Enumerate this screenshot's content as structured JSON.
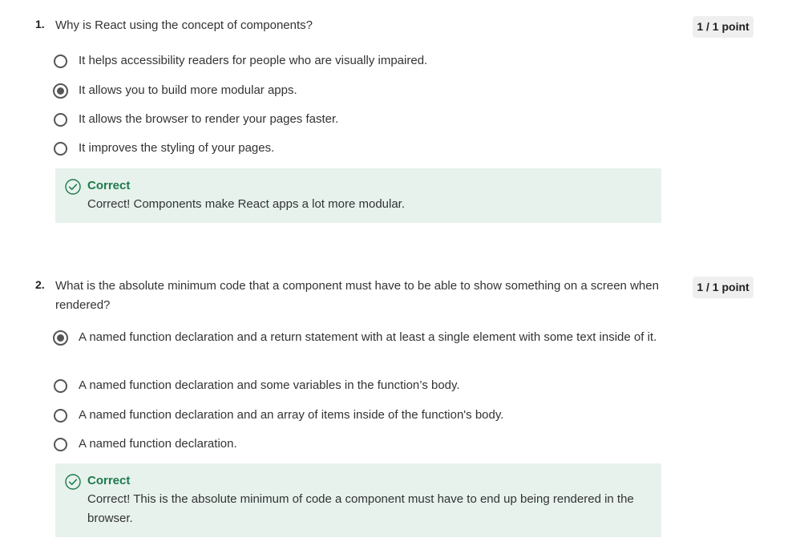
{
  "questions": [
    {
      "number": "1.",
      "text": "Why is React using the concept of components?",
      "points": "1 / 1 point",
      "options": [
        {
          "label": "It helps accessibility readers for people who are visually impaired.",
          "selected": false
        },
        {
          "label": "It allows you to build more modular apps.",
          "selected": true
        },
        {
          "label": "It allows the browser to render your pages faster.",
          "selected": false
        },
        {
          "label": "It improves the styling of your pages.",
          "selected": false
        }
      ],
      "feedback": {
        "icon": "check-circle-icon",
        "title": "Correct",
        "text": "Correct! Components make React apps a lot more modular."
      }
    },
    {
      "number": "2.",
      "text": "What is the absolute minimum code that a component must have to be able to show something on a screen when rendered?",
      "points": "1 / 1 point",
      "options": [
        {
          "label": "A named function declaration and a return statement with at least a single element with some text inside of it.",
          "selected": true
        },
        {
          "label": "A named function declaration and some variables in the function’s body.",
          "selected": false
        },
        {
          "label": "A named function declaration and an array of items inside of the function's body.",
          "selected": false
        },
        {
          "label": "A named function declaration.",
          "selected": false
        }
      ],
      "feedback": {
        "icon": "check-circle-icon",
        "title": "Correct",
        "text": "Correct! This is the absolute minimum of code a component must have to end up being rendered in the browser."
      }
    }
  ],
  "colors": {
    "correct_green": "#1e7a4b",
    "feedback_bg": "#e7f2ed",
    "points_bg": "#efefef",
    "radio_border": "#555555"
  }
}
